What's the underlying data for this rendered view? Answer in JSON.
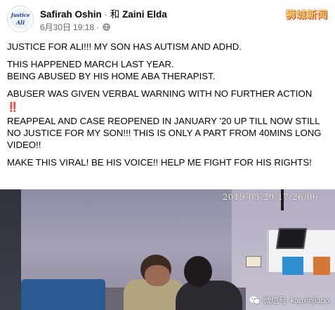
{
  "header": {
    "avatar_text_top": "Justice",
    "avatar_text_bottom": "Ali",
    "author": "Safirah Oshin",
    "separator": " · ",
    "with_prefix": "和 ",
    "tagged": "Zaini Elda",
    "date": "6月30日",
    "time": "19:18",
    "dot": "·",
    "privacy_icon": "globe-icon"
  },
  "source_watermark": "狮城新闻",
  "post": {
    "line1": "JUSTICE FOR ALI!!! MY SON HAS AUTISM AND ADHD.",
    "line2": "THIS HAPPENED MARCH LAST YEAR.\nBEING ABUSED BY HIS HOME ABA THERAPIST.",
    "line3": "ABUSER WAS GIVEN VERBAL WARNING WITH NO FURTHER ACTION",
    "emoji": "‼️",
    "line4": "REAPPEAL AND CASE REOPENED IN JANUARY '20 UP TILL NOW STILL NO JUSTICE FOR MY SON!!! THIS IS ONLY A PART FROM 40MINS LONG VIDEO!!",
    "line5": "MAKE THIS VIRAL! BE HIS VOICE!! HELP ME FIGHT FOR HIS RIGHTS!"
  },
  "video": {
    "timestamp": "2019-03-29 17:26:06",
    "wechat_watermark": "微信号: kanxinjiapo",
    "wechat_icon": "wechat-icon"
  }
}
